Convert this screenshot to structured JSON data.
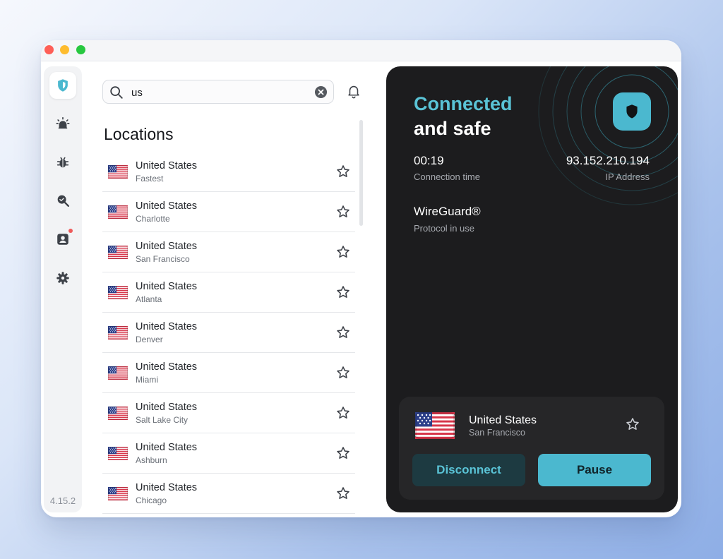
{
  "sidebar": {
    "items": [
      {
        "icon": "shield-icon",
        "active": true
      },
      {
        "icon": "alarm-icon",
        "active": false
      },
      {
        "icon": "bug-icon",
        "active": false
      },
      {
        "icon": "search-shield-icon",
        "active": false
      },
      {
        "icon": "account-icon",
        "active": false,
        "badge": true
      },
      {
        "icon": "gear-icon",
        "active": false
      }
    ],
    "version": "4.15.2"
  },
  "search": {
    "value": "us",
    "placeholder": ""
  },
  "locations": {
    "title": "Locations",
    "items": [
      {
        "country": "United States",
        "city": "Fastest"
      },
      {
        "country": "United States",
        "city": "Charlotte"
      },
      {
        "country": "United States",
        "city": "San Francisco"
      },
      {
        "country": "United States",
        "city": "Atlanta"
      },
      {
        "country": "United States",
        "city": "Denver"
      },
      {
        "country": "United States",
        "city": "Miami"
      },
      {
        "country": "United States",
        "city": "Salt Lake City"
      },
      {
        "country": "United States",
        "city": "Ashburn"
      },
      {
        "country": "United States",
        "city": "Chicago"
      }
    ]
  },
  "connection": {
    "status_line1": "Connected",
    "status_line2": "and safe",
    "time_value": "00:19",
    "time_label": "Connection time",
    "ip_value": "93.152.210.194",
    "ip_label": "IP Address",
    "protocol_value": "WireGuard®",
    "protocol_label": "Protocol in use",
    "current": {
      "country": "United States",
      "city": "San Francisco"
    },
    "disconnect_label": "Disconnect",
    "pause_label": "Pause"
  },
  "colors": {
    "accent": "#4bb8cf",
    "accent_text": "#5ac3d6",
    "panel_bg": "#1c1c1e",
    "card_bg": "#262628",
    "badge_red": "#ee5a5a"
  }
}
